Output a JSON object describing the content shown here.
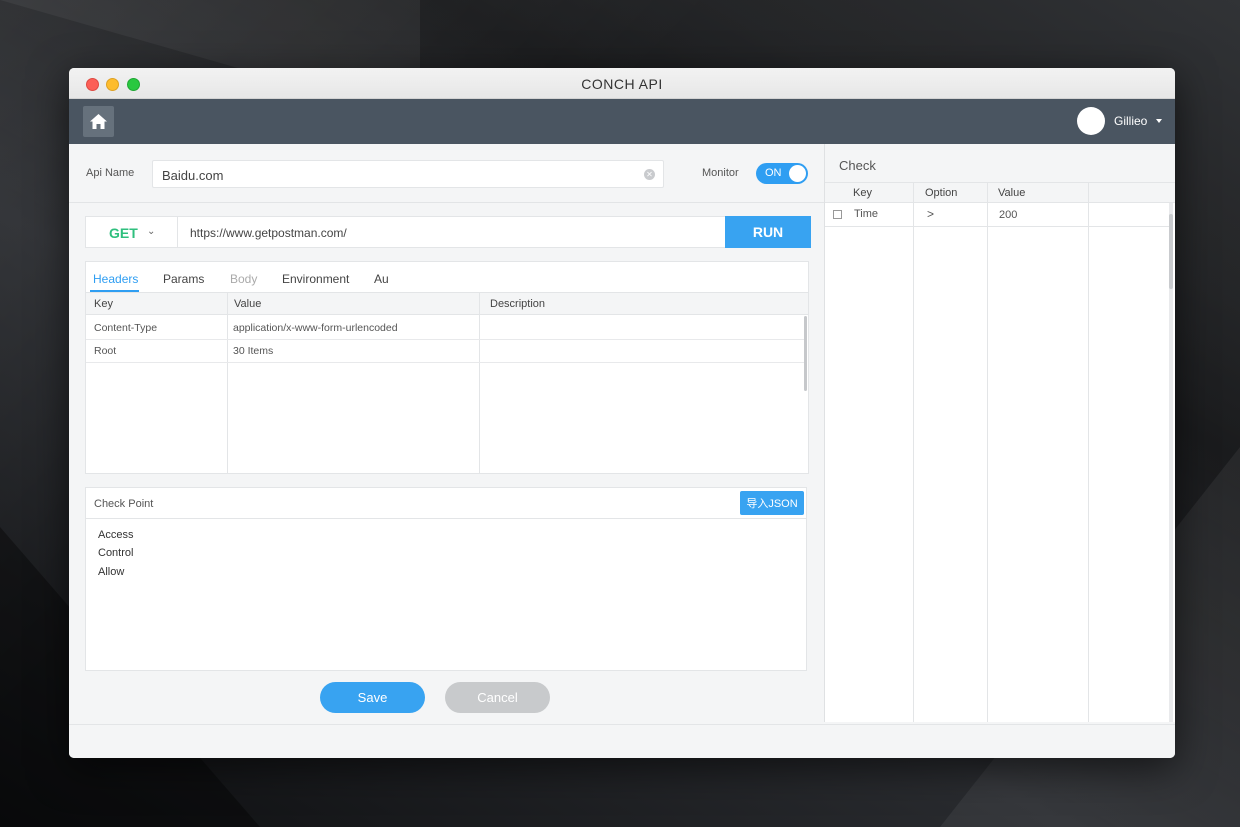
{
  "window": {
    "title": "CONCH API"
  },
  "nav": {
    "user_name": "Gillieo"
  },
  "form": {
    "api_name_label": "Api Name",
    "api_name_value": "Baidu.com",
    "monitor_label": "Monitor",
    "monitor_toggle_label": "ON",
    "method": "GET",
    "url": "https://www.getpostman.com/",
    "run_label": "RUN"
  },
  "tabs": [
    "Headers",
    "Params",
    "Body",
    "Environment",
    "Au"
  ],
  "params_table": {
    "columns": [
      "Key",
      "Value",
      "Description"
    ],
    "rows": [
      {
        "key": "Content-Type",
        "value": "application/x-www-form-urlencoded",
        "description": ""
      },
      {
        "key": "Root",
        "value": "30 Items",
        "description": ""
      }
    ]
  },
  "checkpoint": {
    "title": "Check Point",
    "import_button": "导入JSON",
    "lines": [
      "Access",
      "Control",
      "Allow"
    ]
  },
  "actions": {
    "save": "Save",
    "cancel": "Cancel"
  },
  "check_panel": {
    "title": "Check",
    "columns": [
      "Key",
      "Option",
      "Value"
    ],
    "rows": [
      {
        "key": "Time",
        "option": ">",
        "value": "200",
        "checked": false
      }
    ]
  },
  "colors": {
    "accent": "#38a3f1",
    "method_get": "#2fbf7e",
    "navbar": "#4a5561"
  }
}
